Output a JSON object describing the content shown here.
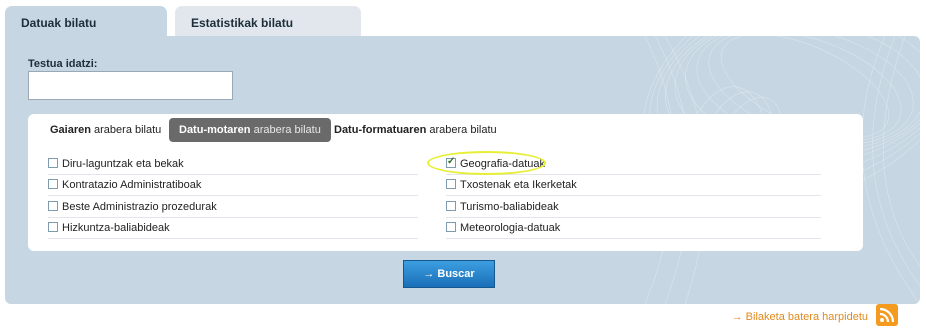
{
  "tabs": {
    "search": "Datuak bilatu",
    "stats": "Estatistikak bilatu"
  },
  "search": {
    "label": "Testua idatzi:",
    "value": ""
  },
  "filters": {
    "tabs": [
      {
        "bold": "Gaiaren",
        "rest": " arabera bilatu"
      },
      {
        "bold": "Datu-motaren",
        "rest": " arabera bilatu"
      },
      {
        "bold": "Datu-formatuaren",
        "rest": " arabera bilatu"
      }
    ],
    "active_tab": "Datu-motaren arabera bilatu",
    "left_options": [
      "Diru-laguntzak eta bekak",
      "Kontratazio Administratiboak",
      "Beste Administrazio prozedurak",
      "Hizkuntza-baliabideak"
    ],
    "right_options": [
      "Geografia-datuak",
      "Txostenak eta Ikerketak",
      "Turismo-baliabideak",
      "Meteorologia-datuak"
    ],
    "checked": [
      "Geografia-datuak"
    ]
  },
  "buttons": {
    "search": "→ Buscar"
  },
  "subscribe": {
    "label": "→ Bilaketa batera harpidetu",
    "icon": "rss-icon"
  },
  "colors": {
    "panel": "#c6d7e3",
    "active_filter_tab": "#6a6a6a",
    "button": "#1b6fb8",
    "link": "#e08a1e",
    "highlight": "#e6ef35"
  }
}
